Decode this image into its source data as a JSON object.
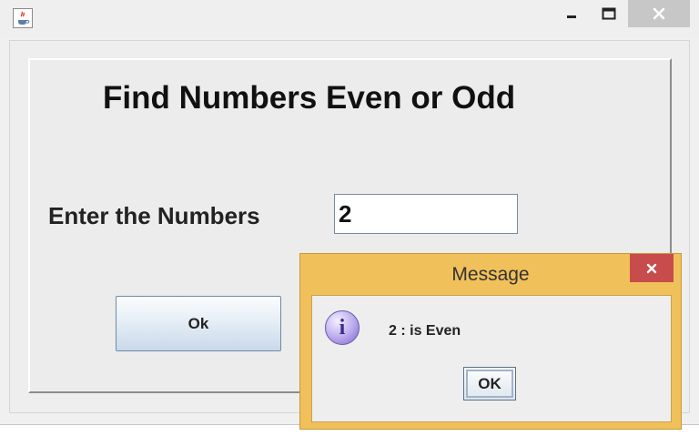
{
  "window": {
    "icon": "java-coffee-cup-icon",
    "controls": {
      "minimize_icon": "minimize-icon",
      "maximize_icon": "maximize-icon",
      "close_icon": "close-icon"
    }
  },
  "form": {
    "heading": "Find Numbers Even or Odd",
    "input_label": "Enter the Numbers",
    "input_value": "2",
    "ok_label": "Ok"
  },
  "dialog": {
    "title": "Message",
    "icon": "info-icon",
    "icon_glyph": "i",
    "message": "2 : is Even",
    "ok_label": "OK",
    "colors": {
      "frame": "#f0c05a",
      "close": "#c84c4c"
    }
  }
}
